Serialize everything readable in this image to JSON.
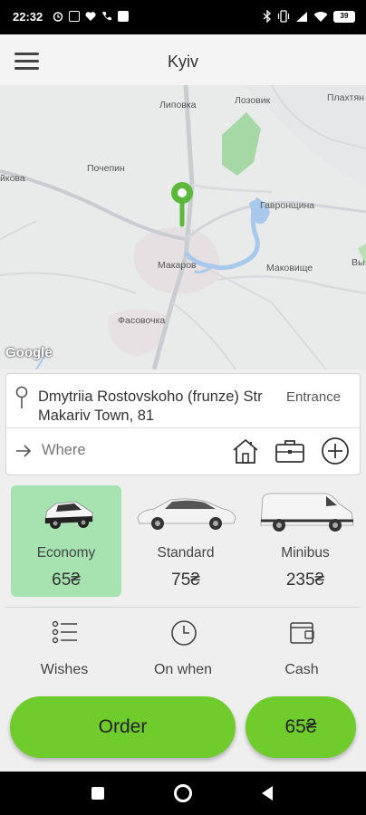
{
  "status_bar": {
    "time": "22:32",
    "battery": "39"
  },
  "header": {
    "city": "Kyiv"
  },
  "map": {
    "labels": [
      "Липовка",
      "Лозовик",
      "Плахтян",
      "Почепин",
      "йкова",
      "Гавронщина",
      "Макаров",
      "Маковище",
      "Вы",
      "Фасовочка"
    ],
    "attribution": "Google"
  },
  "address": {
    "pickup": "Dmytriia Rostovskoho (frunze) Str Makariv Town, 81",
    "entrance_label": "Entrance",
    "where_placeholder": "Where"
  },
  "tariffs": [
    {
      "name": "Economy",
      "price": "65₴",
      "selected": true
    },
    {
      "name": "Standard",
      "price": "75₴",
      "selected": false
    },
    {
      "name": "Minibus",
      "price": "235₴",
      "selected": false
    }
  ],
  "options": [
    {
      "label": "Wishes",
      "icon": "list-icon"
    },
    {
      "label": "On when",
      "icon": "clock-icon"
    },
    {
      "label": "Cash",
      "icon": "wallet-icon"
    }
  ],
  "order": {
    "button_label": "Order",
    "price": "65₴"
  },
  "colors": {
    "accent": "#6fcc2c",
    "selected_tariff": "#a6e3b1",
    "pin": "#5cb83a"
  }
}
